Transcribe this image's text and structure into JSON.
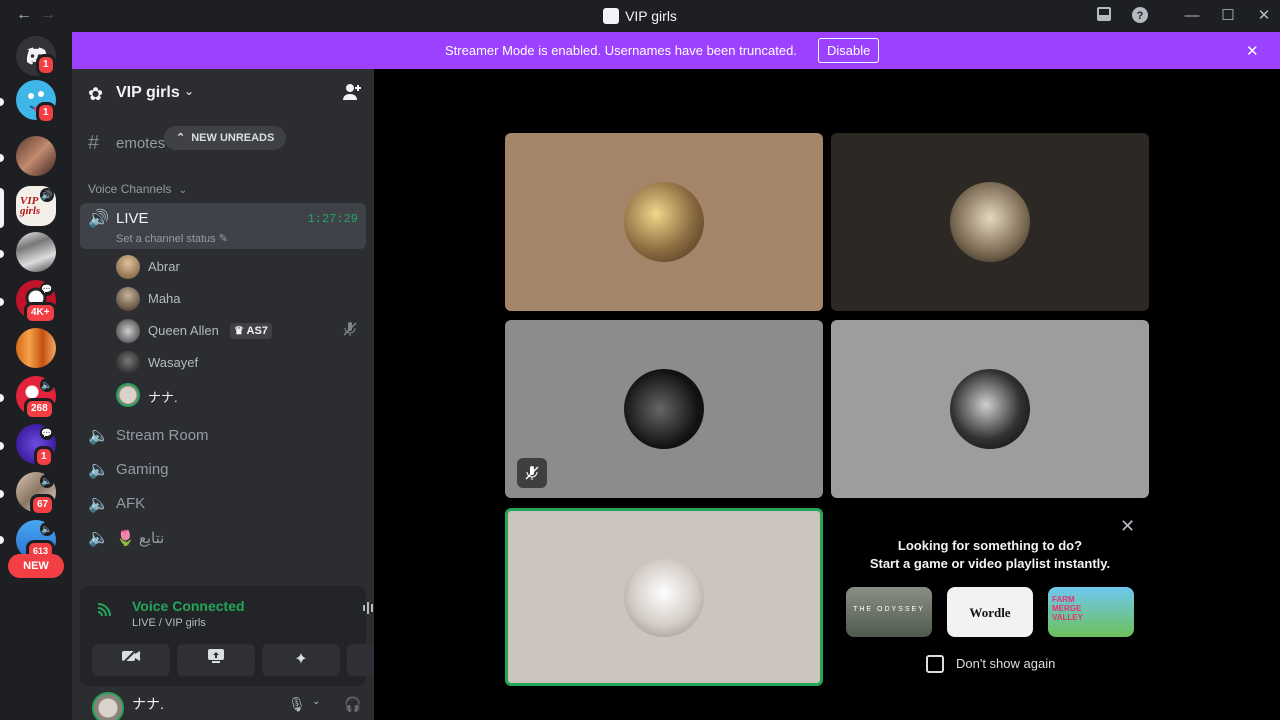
{
  "window": {
    "title": "VIP girls",
    "back": "←",
    "forward": "→"
  },
  "titlebar_icons": [
    "inbox-icon",
    "help-icon",
    "minimize-icon",
    "maximize-icon",
    "close-icon"
  ],
  "banner": {
    "text": "Streamer Mode is enabled. Usernames have been truncated.",
    "button": "Disable",
    "close": "✕"
  },
  "rail": {
    "home_badge": "1",
    "servers": [
      {
        "name": "emoji-server",
        "badge": "1"
      },
      {
        "name": "group-server"
      },
      {
        "name": "vip-girls-server",
        "label": "VIP girls",
        "active": true
      },
      {
        "name": "bw-server"
      },
      {
        "name": "server-4k",
        "badge": "4K+"
      },
      {
        "name": "orange-server"
      },
      {
        "name": "red-server",
        "badge": "268"
      },
      {
        "name": "purple-server",
        "badge": "1"
      },
      {
        "name": "portrait-server",
        "badge": "67"
      },
      {
        "name": "blue-server",
        "badge": "613"
      }
    ],
    "new_label": "NEW"
  },
  "sidebar": {
    "server_name": "VIP girls",
    "new_unreads": "NEW UNREADS",
    "text_channel": "emotes",
    "voice_category": "Voice Channels",
    "live": {
      "name": "LIVE",
      "timer": "1:27:29",
      "status": "Set a channel status"
    },
    "voice_users": [
      {
        "name": "Abrar"
      },
      {
        "name": "Maha"
      },
      {
        "name": "Queen Allen",
        "tag": "AS7",
        "muted": true
      },
      {
        "name": "Wasayef"
      },
      {
        "name": "ナナ."
      }
    ],
    "voice_channels": [
      "Stream Room",
      "Gaming",
      "AFK",
      "نتايع 🌷"
    ]
  },
  "voice_panel": {
    "status": "Voice Connected",
    "location": "LIVE / VIP girls"
  },
  "user": {
    "name": "ナナ."
  },
  "activity": {
    "title_line1": "Looking for something to do?",
    "title_line2": "Start a game or video playlist instantly.",
    "games": [
      {
        "name": "THE ODYSSEY"
      },
      {
        "name": "Wordle"
      },
      {
        "name": "FARM MERGE VALLEY"
      }
    ],
    "dont_show": "Don't show again"
  },
  "colors": {
    "accent": "#9b41ff",
    "voice_green": "#23a55a",
    "badge_red": "#f23f43"
  }
}
